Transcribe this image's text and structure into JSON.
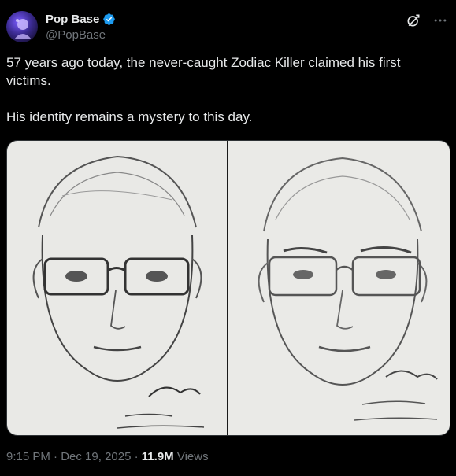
{
  "author": {
    "display_name": "Pop Base",
    "handle": "@PopBase",
    "verified": true,
    "avatar_icon": "avatar-icon"
  },
  "actions": {
    "grok_icon": "grok-icon",
    "more_icon": "more-icon"
  },
  "tweet": {
    "text": "57 years ago today, the never-caught Zodiac Killer claimed his first victims.\n\nHis identity remains a mystery to this day."
  },
  "media": {
    "type": "image",
    "panels": [
      "sketch-left",
      "sketch-right"
    ]
  },
  "meta": {
    "time": "9:15 PM",
    "separator": "·",
    "date": "Dec 19, 2025",
    "views_count": "11.9M",
    "views_label": "Views"
  },
  "colors": {
    "background": "#000000",
    "text": "#e7e9ea",
    "muted": "#71767b",
    "verified_blue": "#1d9bf0"
  }
}
